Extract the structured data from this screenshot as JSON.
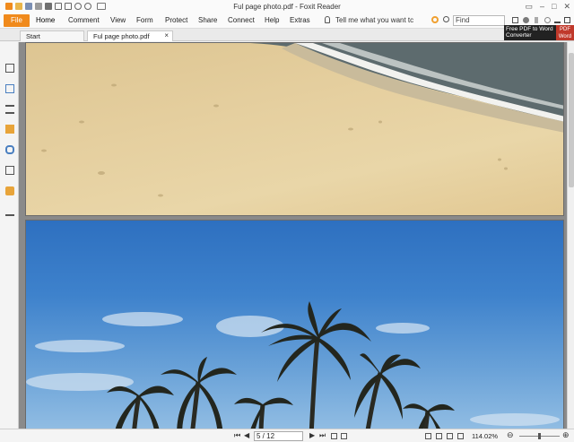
{
  "window": {
    "title": "Ful page photo.pdf - Foxit Reader"
  },
  "ribbon": {
    "file_label": "File",
    "tabs": [
      "Home",
      "Comment",
      "View",
      "Form",
      "Protect",
      "Share",
      "Connect",
      "Help",
      "Extras"
    ],
    "tell_me": "Tell me what you want tc",
    "find_placeholder": "Find"
  },
  "doc_tabs": [
    {
      "label": "Start",
      "active": false
    },
    {
      "label": "Ful page photo.pdf",
      "active": true,
      "close": "×"
    }
  ],
  "tooltip": {
    "line1": "Free PDF to Word",
    "line2": "Converter",
    "badge1": "PDF",
    "badge2": "Word"
  },
  "status": {
    "page_display": "5 / 12",
    "zoom": "114.02%",
    "zoom_out": "⊖",
    "zoom_in": "⊕"
  },
  "colors": {
    "file_button": "#f08a1c",
    "accent": "#f0a030"
  }
}
